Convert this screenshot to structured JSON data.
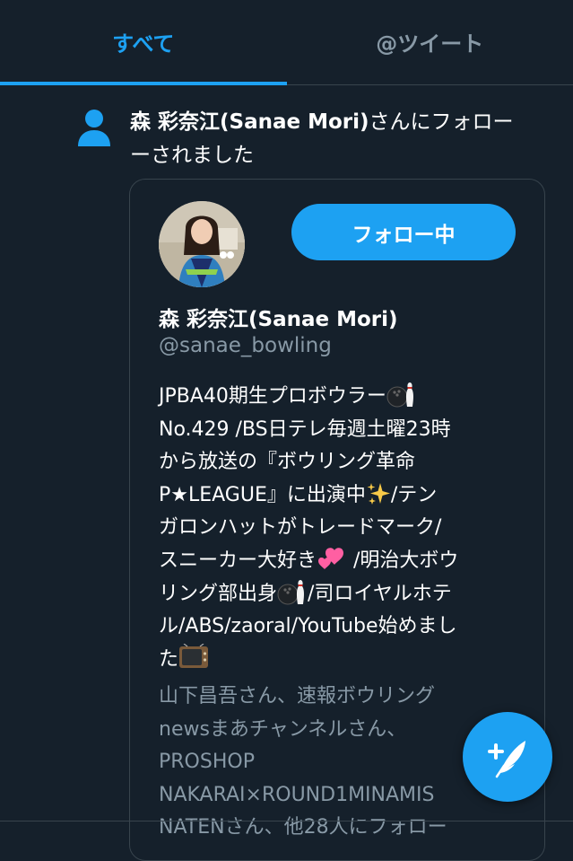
{
  "tabs": [
    {
      "label": "すべて",
      "active": true
    },
    {
      "label": "@ツイート",
      "active": false
    }
  ],
  "notification": {
    "icon": "person-icon",
    "user_name": "森 彩奈江(Sanae Mori)",
    "action_text": "さんにフォロー",
    "action_text_2": "ーされました"
  },
  "profile_card": {
    "follow_button_label": "フォロー中",
    "display_name": "森 彩奈江(Sanae Mori)",
    "handle": "@sanae_bowling",
    "bio_lines": [
      "JPBA40期生プロボウラー",
      "No.429 /BS日テレ毎週土曜23時",
      "から放送の『ボウリング革命",
      "P★LEAGUE』に出演中",
      "ガロンハットがトレードマーク/",
      "スニーカー大好き",
      "リング部出身",
      "ル/ABS/zaoral/YouTube始めまし",
      "た"
    ],
    "bio_line_tails": {
      "line3": "/テン",
      "line5": " /明治大ボウ",
      "line6": "/司ロイヤルホテ"
    },
    "followers_lines": [
      "山下昌吾さん、速報ボウリング",
      "newsまあチャンネルさん、",
      "PROSHOP",
      "NAKARAI×ROUND1MINAMIS",
      "NATENさん、他28人にフォロー"
    ]
  },
  "fab": {
    "icon": "compose-feather-icon"
  },
  "colors": {
    "background": "#15202b",
    "accent": "#1da1f2",
    "secondary_text": "#8899a6",
    "border": "#38444d"
  }
}
